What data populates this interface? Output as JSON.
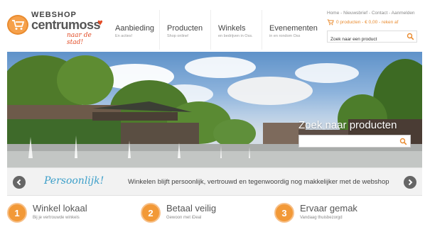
{
  "logo": {
    "line1": "WEBSHOP",
    "line2": "centrumoss",
    "tagline": "naar de stad!"
  },
  "nav": [
    {
      "title": "Aanbieding",
      "sub": "En acties!"
    },
    {
      "title": "Producten",
      "sub": "Shop online!"
    },
    {
      "title": "Winkels",
      "sub": "en bedrijven in Oss."
    },
    {
      "title": "Evenementen",
      "sub": "in en rondom Oss"
    }
  ],
  "toplinks": "Home - Nieuwsbrief - Contact - Aanmelden",
  "cart": "0 producten - € 0,00 - reken af",
  "search": {
    "placeholder": "Zoek naar een product"
  },
  "hero": {
    "search_title": "Zoek naar producten",
    "search_value": ""
  },
  "strip": {
    "script": "Persoonlijk!",
    "text": "Winkelen blijft persoonlijk, vertrouwd en tegenwoordig nog makkelijker met de webshop"
  },
  "features": [
    {
      "number": "1",
      "title": "Winkel lokaal",
      "sub": "Bij je vertrouwde winkels"
    },
    {
      "number": "2",
      "title": "Betaal veilig",
      "sub": "Gewoon met iDeal"
    },
    {
      "number": "3",
      "title": "Ervaar gemak",
      "sub": "Vandaag thuisbezorgd"
    }
  ],
  "colors": {
    "accent": "#f29937",
    "brand_red": "#e24c26",
    "script_blue": "#3c9fc9"
  }
}
